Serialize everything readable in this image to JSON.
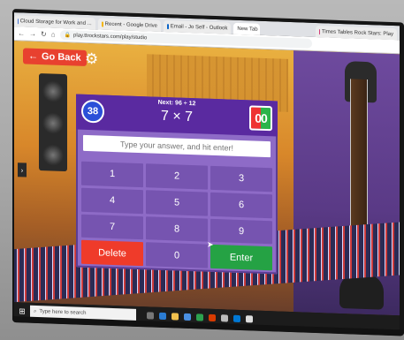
{
  "browser": {
    "tabs": [
      {
        "label": "Cloud Storage for Work and ...",
        "active": false
      },
      {
        "label": "Recent - Google Drive",
        "active": false
      },
      {
        "label": "Email - Jo Self - Outlook",
        "active": false
      },
      {
        "label": "New Tab",
        "active": true
      },
      {
        "label": "Times Tables Rock Stars: Play",
        "active": false
      }
    ],
    "url": "play.ttrockstars.com/play/studio"
  },
  "game": {
    "go_back_label": "Go Back",
    "next_label": "Next: 96 ÷ 12",
    "problem": "7 × 7",
    "score": "38",
    "timer": "00",
    "answer_placeholder": "Type your answer, and hit enter!",
    "keys": [
      "1",
      "2",
      "3",
      "4",
      "5",
      "6",
      "7",
      "8",
      "9",
      "Delete",
      "0",
      "Enter"
    ],
    "colors": {
      "delete": "#ef3b2a",
      "enter": "#25a244",
      "panel": "#8e6bc7",
      "header": "#5a2aa0"
    }
  },
  "taskbar": {
    "search_placeholder": "Type here to search"
  }
}
